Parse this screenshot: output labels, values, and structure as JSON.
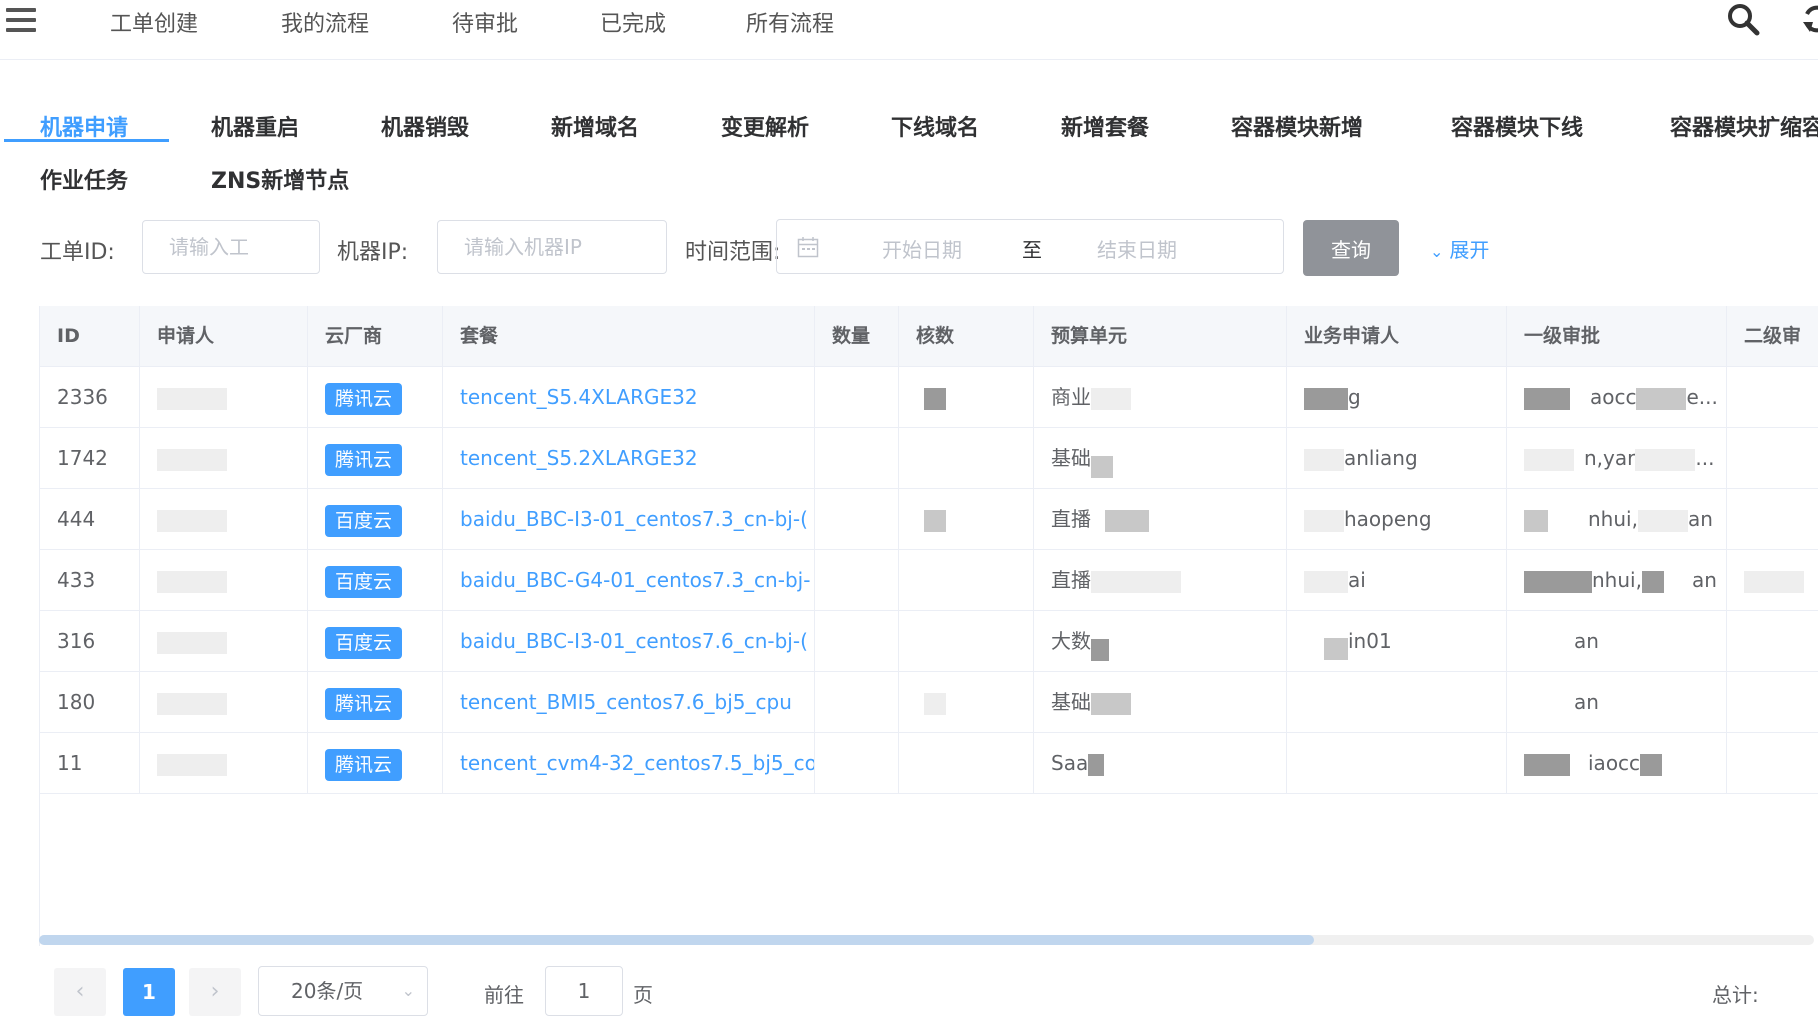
{
  "topnav": {
    "items": [
      "工单创建",
      "我的流程",
      "待审批",
      "已完成",
      "所有流程"
    ],
    "icons": [
      "search-icon",
      "refresh-icon",
      "fullscreen-icon"
    ]
  },
  "tabs": [
    {
      "label": "机器申请",
      "active": true
    },
    {
      "label": "机器重启"
    },
    {
      "label": "机器销毁"
    },
    {
      "label": "新增域名"
    },
    {
      "label": "变更解析"
    },
    {
      "label": "下线域名"
    },
    {
      "label": "新增套餐"
    },
    {
      "label": "容器模块新增"
    },
    {
      "label": "容器模块下线"
    },
    {
      "label": "容器模块扩缩容"
    },
    {
      "label": "作业任务"
    },
    {
      "label": "ZNS新增节点"
    }
  ],
  "filters": {
    "ticket_id_label": "工单ID:",
    "ticket_id_placeholder": "请输入工",
    "machine_ip_label": "机器IP:",
    "machine_ip_placeholder": "请输入机器IP",
    "time_range_label": "时间范围:",
    "start_placeholder": "开始日期",
    "range_separator": "至",
    "end_placeholder": "结束日期",
    "query_button": "查询",
    "expand_link": "展开"
  },
  "table": {
    "columns": [
      "ID",
      "申请人",
      "云厂商",
      "套餐",
      "数量",
      "核数",
      "预算单元",
      "业务申请人",
      "一级审批",
      "二级审"
    ],
    "rows": [
      {
        "id": "2336",
        "vendor": "腾讯云",
        "package": "tencent_S5.4XLARGE32",
        "budget": "商业",
        "requester": "g",
        "approver1": "aocc",
        "approver1_suffix": "e..."
      },
      {
        "id": "1742",
        "vendor": "腾讯云",
        "package": "tencent_S5.2XLARGE32",
        "budget": "基础",
        "requester": "anliang",
        "approver1": "n,yar",
        "approver1_suffix": "..."
      },
      {
        "id": "444",
        "vendor": "百度云",
        "package": "baidu_BBC-I3-01_centos7.3_cn-bj-(",
        "budget": "直播",
        "requester": "haopeng",
        "approver1": "nhui,",
        "approver1_suffix": "an"
      },
      {
        "id": "433",
        "vendor": "百度云",
        "package": "baidu_BBC-G4-01_centos7.3_cn-bj-",
        "budget": "直播",
        "requester": "ai",
        "approver1": "nhui,",
        "approver1_suffix": "an"
      },
      {
        "id": "316",
        "vendor": "百度云",
        "package": "baidu_BBC-I3-01_centos7.6_cn-bj-(",
        "budget": "大数",
        "requester": "in01",
        "approver1": "an",
        "approver1_suffix": ""
      },
      {
        "id": "180",
        "vendor": "腾讯云",
        "package": "tencent_BMI5_centos7.6_bj5_cpu",
        "budget": "基础",
        "requester": "",
        "approver1": "an",
        "approver1_suffix": ""
      },
      {
        "id": "11",
        "vendor": "腾讯云",
        "package": "tencent_cvm4-32_centos7.5_bj5_co",
        "budget": "Saa",
        "requester": "",
        "approver1": "iaocc",
        "approver1_suffix": ""
      }
    ]
  },
  "pagination": {
    "current_page": "1",
    "page_size": "20条/页",
    "goto_label": "前往",
    "goto_value": "1",
    "page_suffix": "页",
    "total_label": "总计:"
  }
}
